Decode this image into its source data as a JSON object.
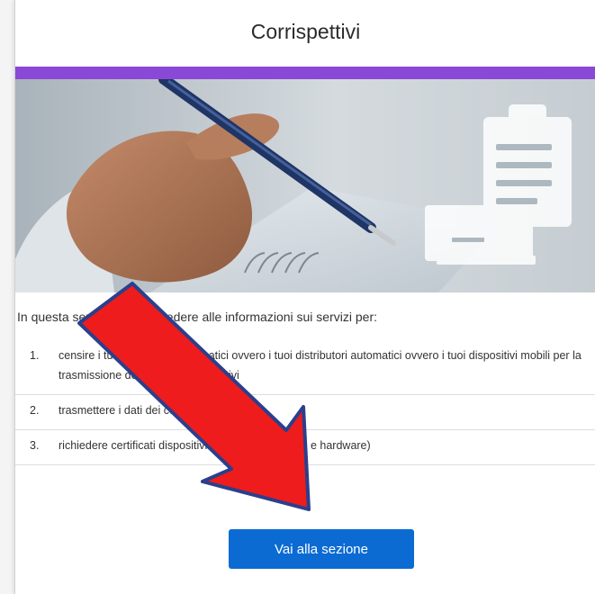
{
  "card": {
    "title": "Corrispettivi",
    "intro": "In questa sezione puoi accedere alle informazioni sui servizi per:",
    "items": [
      {
        "num": "1.",
        "text": "censire i tuoi registratori telematici ovvero i tuoi distributori automatici ovvero i tuoi dispositivi mobili per la trasmissione dei dati dei corrispettivi"
      },
      {
        "num": "2.",
        "text": "trasmettere i dati dei corrispettivi"
      },
      {
        "num": "3.",
        "text": "richiedere certificati dispositivi (produttori software e hardware)"
      }
    ],
    "cta_label": "Vai alla sezione"
  },
  "colors": {
    "accent": "#8a48d6",
    "cta": "#0b6bd3",
    "arrow": "#ee1c1c",
    "arrow_outline": "#2b3f8c"
  }
}
